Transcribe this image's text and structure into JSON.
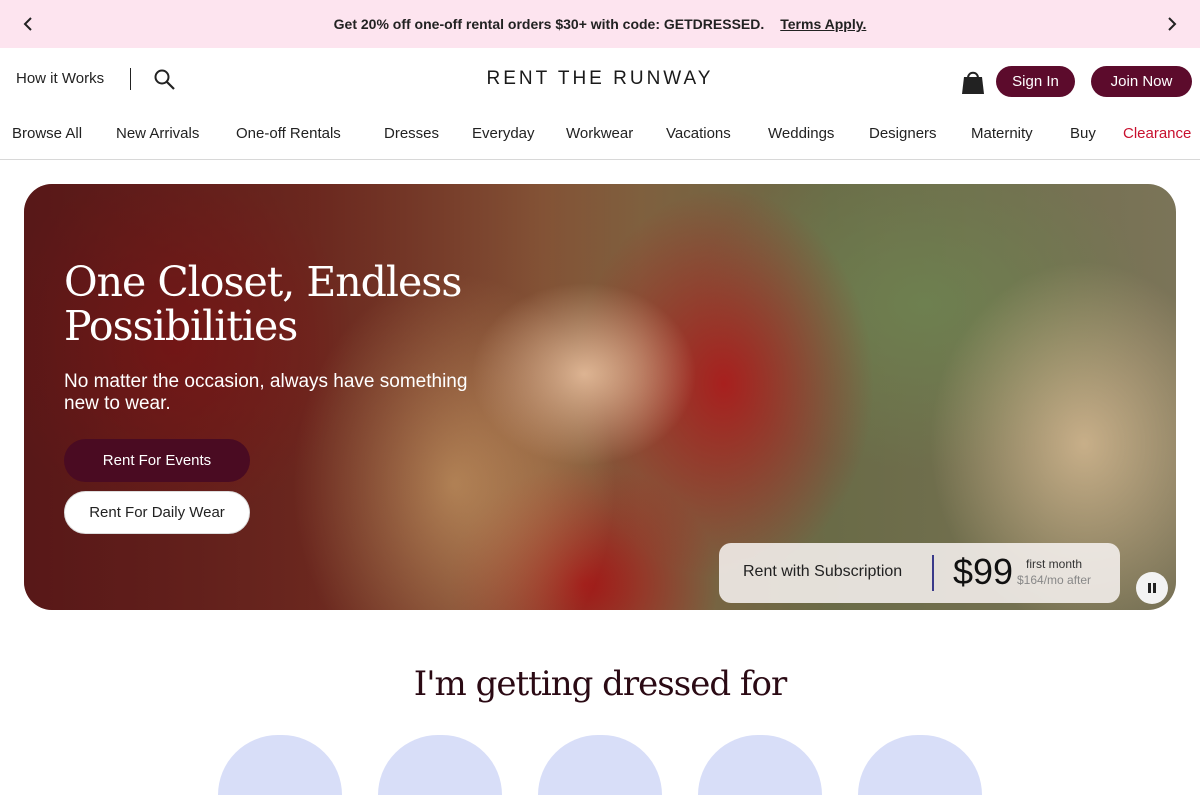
{
  "promo": {
    "text": "Get 20% off one-off rental orders $30+ with code: GETDRESSED.",
    "terms_label": "Terms Apply.",
    "prev_icon": "chevron-left-icon",
    "next_icon": "chevron-right-icon"
  },
  "header": {
    "how_it_works": "How it Works",
    "search_icon": "search-icon",
    "logo": "RENT THE RUNWAY",
    "bag_icon": "shopping-bag-icon",
    "sign_in": "Sign In",
    "join_now": "Join Now"
  },
  "nav": {
    "items": [
      {
        "label": "Browse All"
      },
      {
        "label": "New Arrivals"
      },
      {
        "label": "One-off Rentals"
      },
      {
        "label": "Dresses"
      },
      {
        "label": "Everyday"
      },
      {
        "label": "Workwear"
      },
      {
        "label": "Vacations"
      },
      {
        "label": "Weddings"
      },
      {
        "label": "Designers"
      },
      {
        "label": "Maternity"
      },
      {
        "label": "Buy"
      },
      {
        "label": "Clearance"
      }
    ]
  },
  "hero": {
    "title": "One Closet, Endless Possibilities",
    "subtitle": "No matter the occasion, always have something new to wear.",
    "btn_events": "Rent For Events",
    "btn_daily": "Rent For Daily Wear",
    "subscription": {
      "label": "Rent with Subscription",
      "price": "$99",
      "first_month": "first month",
      "after": "$164/mo after"
    },
    "pause_icon": "pause-icon"
  },
  "section": {
    "title": "I'm getting dressed for"
  },
  "colors": {
    "promo_bg": "#fde4ef",
    "brand": "#5c0b2c",
    "clearance": "#c8102e"
  }
}
